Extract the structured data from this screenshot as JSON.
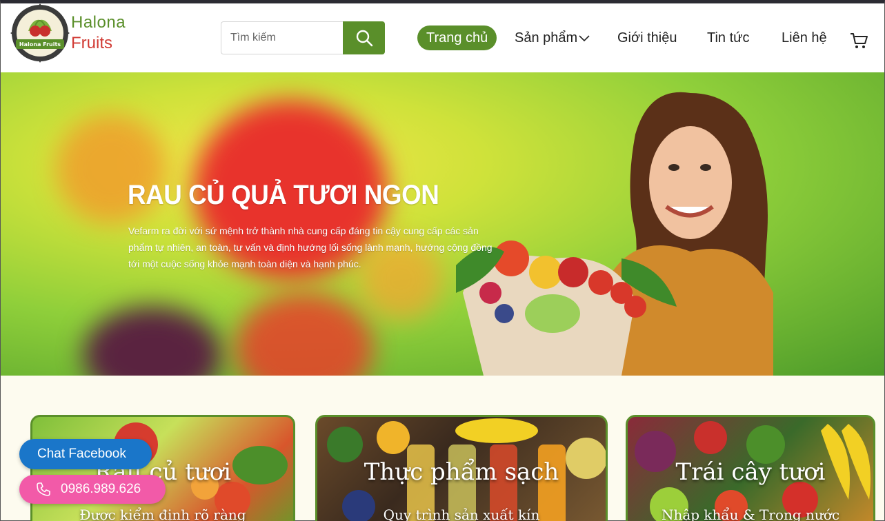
{
  "brand": {
    "name_line1": "Halona",
    "name_line2": "Fruits",
    "badge_text": "Halona Fruits",
    "colors": {
      "primary": "#5a8f2a",
      "accent": "#d13b34"
    }
  },
  "search": {
    "placeholder": "Tìm kiếm",
    "icon": "search-icon"
  },
  "nav": {
    "items": [
      {
        "label": "Trang chủ",
        "active": true
      },
      {
        "label": "Sản phẩm",
        "has_dropdown": true
      },
      {
        "label": "Giới thiệu"
      },
      {
        "label": "Tin tức"
      },
      {
        "label": "Liên hệ"
      }
    ],
    "cart_icon": "cart-icon"
  },
  "hero": {
    "title": "RAU CỦ QUẢ TƯƠI NGON",
    "description": "Vefarm ra đời với sứ mệnh trở thành nhà cung cấp đáng tin cậy cung cấp các sản phẩm tự nhiên, an toàn, tư vấn và định hướng lối sống lành mạnh, hướng cộng đồng tới một cuộc sống khỏe mạnh toàn diện và hạnh phúc."
  },
  "categories": [
    {
      "title": "Rau củ tươi",
      "subtitle": "Được kiểm định rõ ràng"
    },
    {
      "title": "Thực phẩm sạch",
      "subtitle": "Quy trình sản xuất kín"
    },
    {
      "title": "Trái cây tươi",
      "subtitle": "Nhập khẩu & Trong nước"
    }
  ],
  "floating": {
    "facebook_label": "Chat Facebook",
    "phone_label": "0986.989.626",
    "colors": {
      "facebook": "#1a76c9",
      "phone": "#f25aa8"
    }
  }
}
